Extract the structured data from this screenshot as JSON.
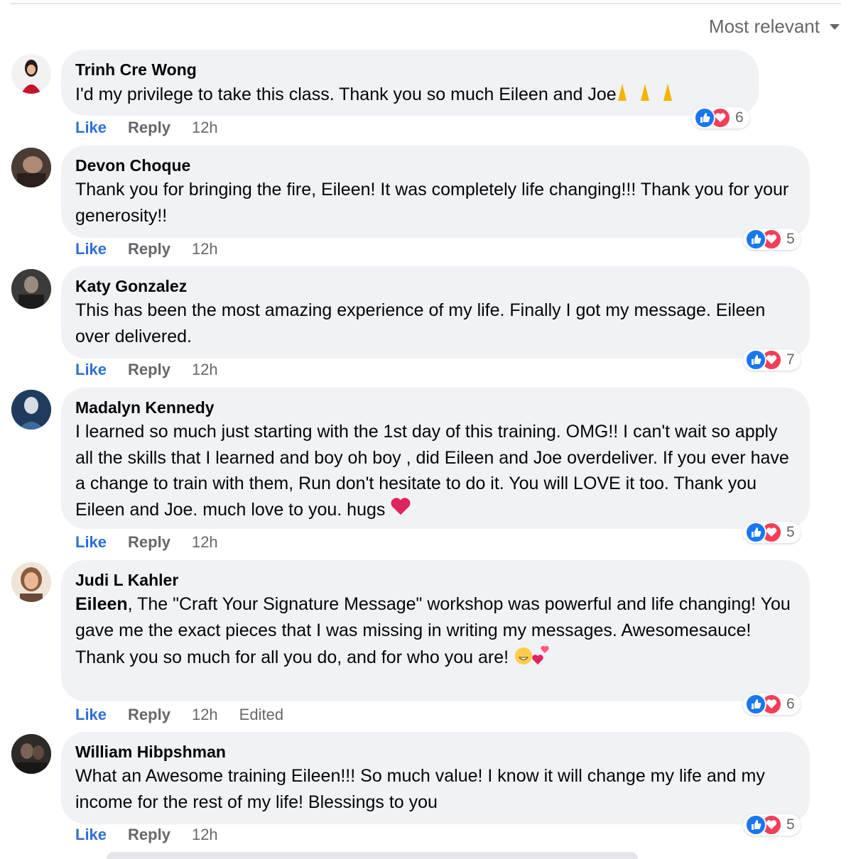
{
  "sort": {
    "label": "Most relevant"
  },
  "colors": {
    "like_blue": "#1877f2",
    "love_red": "#f33e58",
    "bubble_bg": "#f0f2f5",
    "link_blue": "#2e6fd8"
  },
  "comments": [
    {
      "author": "Trinh Cre Wong",
      "text": "I'd my privilege to take this class. Thank you so much Eileen and Joe",
      "emoji": "praying-hands-emoji x3",
      "reaction_count": "6",
      "actions": {
        "like": "Like",
        "reply": "Reply",
        "time": "12h"
      }
    },
    {
      "author": "Devon Choque",
      "text": "Thank you for bringing the fire, Eileen! It was completely life changing!!! Thank you for your generosity!!",
      "reaction_count": "5",
      "actions": {
        "like": "Like",
        "reply": "Reply",
        "time": "12h"
      }
    },
    {
      "author": "Katy Gonzalez",
      "text": "This has been the most amazing experience of my life. Finally I got my message. Eileen over delivered.",
      "reaction_count": "7",
      "actions": {
        "like": "Like",
        "reply": "Reply",
        "time": "12h"
      }
    },
    {
      "author": "Madalyn Kennedy",
      "text": "I learned so much just starting with the 1st day of this training. OMG!! I can't wait so apply all the skills that I learned and boy oh boy , did Eileen and Joe overdeliver. If you ever have a change to train with them, Run don't hesitate to do it. You will LOVE it too. Thank you Eileen and Joe. much love to you. hugs",
      "emoji": "heart-emoji",
      "reaction_count": "5",
      "actions": {
        "like": "Like",
        "reply": "Reply",
        "time": "12h"
      }
    },
    {
      "author": "Judi L Kahler",
      "mention": "Eileen",
      "text": ", The \"Craft Your Signature Message\" workshop was powerful and life changing! You gave me the exact pieces that I was missing in writing my messages. Awesomesauce! Thank you so much for all you do, and for who you are!",
      "emoji": "grin-and-hearts-emoji",
      "reaction_count": "6",
      "actions": {
        "like": "Like",
        "reply": "Reply",
        "time": "12h",
        "edited": "Edited"
      }
    },
    {
      "author": "William Hibpshman",
      "text": "What an Awesome training Eileen!!! So much value! I know it will change my life and my income for the rest of my life! Blessings to you",
      "reaction_count": "5",
      "actions": {
        "like": "Like",
        "reply": "Reply",
        "time": "12h"
      }
    }
  ]
}
